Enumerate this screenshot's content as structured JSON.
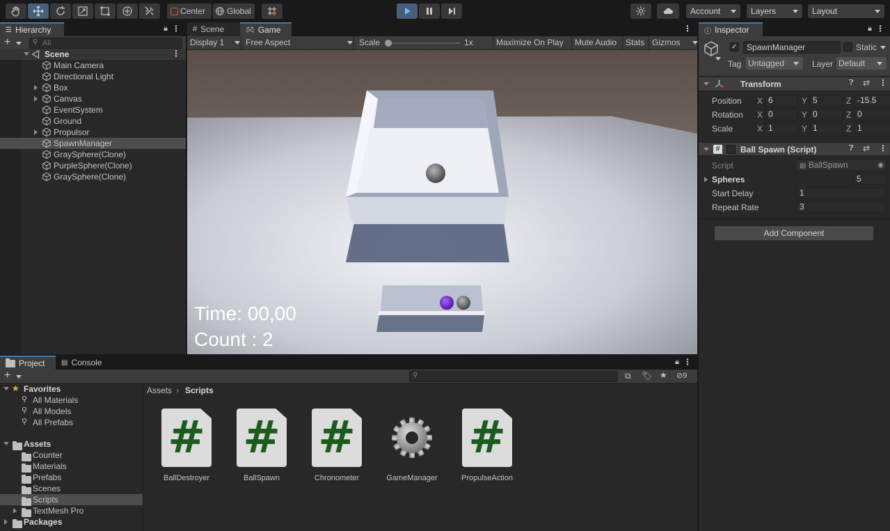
{
  "toolbar": {
    "pivot_label": "Center",
    "space_label": "Global",
    "account_label": "Account",
    "layers_label": "Layers",
    "layout_label": "Layout"
  },
  "hierarchy": {
    "tab_label": "Hierarchy",
    "search_placeholder": "All",
    "scene_name": "Scene",
    "items": [
      {
        "label": "Main Camera",
        "expandable": false
      },
      {
        "label": "Directional Light",
        "expandable": false
      },
      {
        "label": "Box",
        "expandable": true
      },
      {
        "label": "Canvas",
        "expandable": true
      },
      {
        "label": "EventSystem",
        "expandable": false
      },
      {
        "label": "Ground",
        "expandable": false
      },
      {
        "label": "Propulsor",
        "expandable": true
      },
      {
        "label": "SpawnManager",
        "expandable": false,
        "selected": true
      },
      {
        "label": "GraySphere(Clone)",
        "expandable": false
      },
      {
        "label": "PurpleSphere(Clone)",
        "expandable": false
      },
      {
        "label": "GraySphere(Clone)",
        "expandable": false
      }
    ]
  },
  "game": {
    "scene_tab": "Scene",
    "game_tab": "Game",
    "display_label": "Display 1",
    "aspect_label": "Free Aspect",
    "scale_label": "Scale",
    "scale_value": "1x",
    "maximize_label": "Maximize On Play",
    "mute_label": "Mute Audio",
    "stats_label": "Stats",
    "gizmos_label": "Gizmos",
    "time_text": "Time: 00,00",
    "count_text": "Count : 2"
  },
  "inspector": {
    "tab_label": "Inspector",
    "object_name": "SpawnManager",
    "static_label": "Static",
    "tag_label": "Tag",
    "tag_value": "Untagged",
    "layer_label": "Layer",
    "layer_value": "Default",
    "transform": {
      "title": "Transform",
      "position_label": "Position",
      "rotation_label": "Rotation",
      "scale_label": "Scale",
      "position": {
        "x": "6",
        "y": "5",
        "z": "-15.5"
      },
      "rotation": {
        "x": "0",
        "y": "0",
        "z": "0"
      },
      "scale": {
        "x": "1",
        "y": "1",
        "z": "1"
      }
    },
    "ball_spawn": {
      "title": "Ball Spawn (Script)",
      "script_label": "Script",
      "script_value": "BallSpawn",
      "spheres_label": "Spheres",
      "spheres_value": "5",
      "start_delay_label": "Start Delay",
      "start_delay_value": "1",
      "repeat_rate_label": "Repeat Rate",
      "repeat_rate_value": "3"
    },
    "add_component_label": "Add Component"
  },
  "project": {
    "project_tab": "Project",
    "console_tab": "Console",
    "hidden_count": "9",
    "favorites_label": "Favorites",
    "favorites": [
      "All Materials",
      "All Models",
      "All Prefabs"
    ],
    "assets_label": "Assets",
    "asset_folders": [
      "Counter",
      "Materials",
      "Prefabs",
      "Scenes",
      "Scripts",
      "TextMesh Pro"
    ],
    "packages_label": "Packages",
    "breadcrumb_root": "Assets",
    "breadcrumb_current": "Scripts",
    "files": [
      {
        "label": "BallDestroyer",
        "kind": "script"
      },
      {
        "label": "BallSpawn",
        "kind": "script"
      },
      {
        "label": "Chronometer",
        "kind": "script"
      },
      {
        "label": "GameManager",
        "kind": "settings"
      },
      {
        "label": "PropulseAction",
        "kind": "script"
      }
    ]
  },
  "colors": {
    "play_active": "#46607c",
    "selection": "#4d4d4d",
    "script_hash": "#1b5c1d",
    "sphere_purple": "#6a1fc4"
  }
}
